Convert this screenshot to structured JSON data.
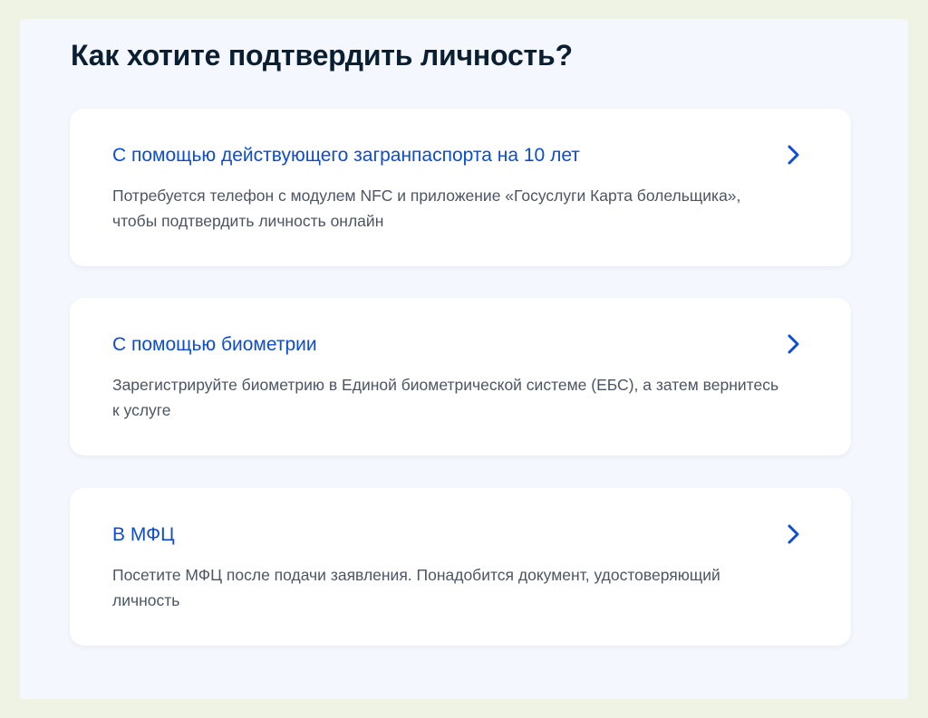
{
  "page": {
    "title": "Как хотите подтвердить личность?"
  },
  "options": [
    {
      "title": "С помощью действующего загранпаспорта на 10 лет",
      "description": "Потребуется телефон с модулем NFC и приложение «Госуслуги Карта болельщика», чтобы подтвердить личность онлайн",
      "icon": "chevron-right-icon"
    },
    {
      "title": "С помощью биометрии",
      "description": "Зарегистрируйте биометрию в Единой биометрической системе (ЕБС), а затем вернитесь к услуге",
      "icon": "chevron-right-icon"
    },
    {
      "title": "В МФЦ",
      "description": "Посетите МФЦ после подачи заявления. Понадобится документ, удостоверяющий личность",
      "icon": "chevron-right-icon"
    }
  ],
  "colors": {
    "outer_background": "#eef3e4",
    "panel_background": "#f4f7fd",
    "card_background": "#ffffff",
    "title_text": "#0b1f33",
    "link_blue": "#0d4cd3",
    "body_text": "#4b5563"
  }
}
